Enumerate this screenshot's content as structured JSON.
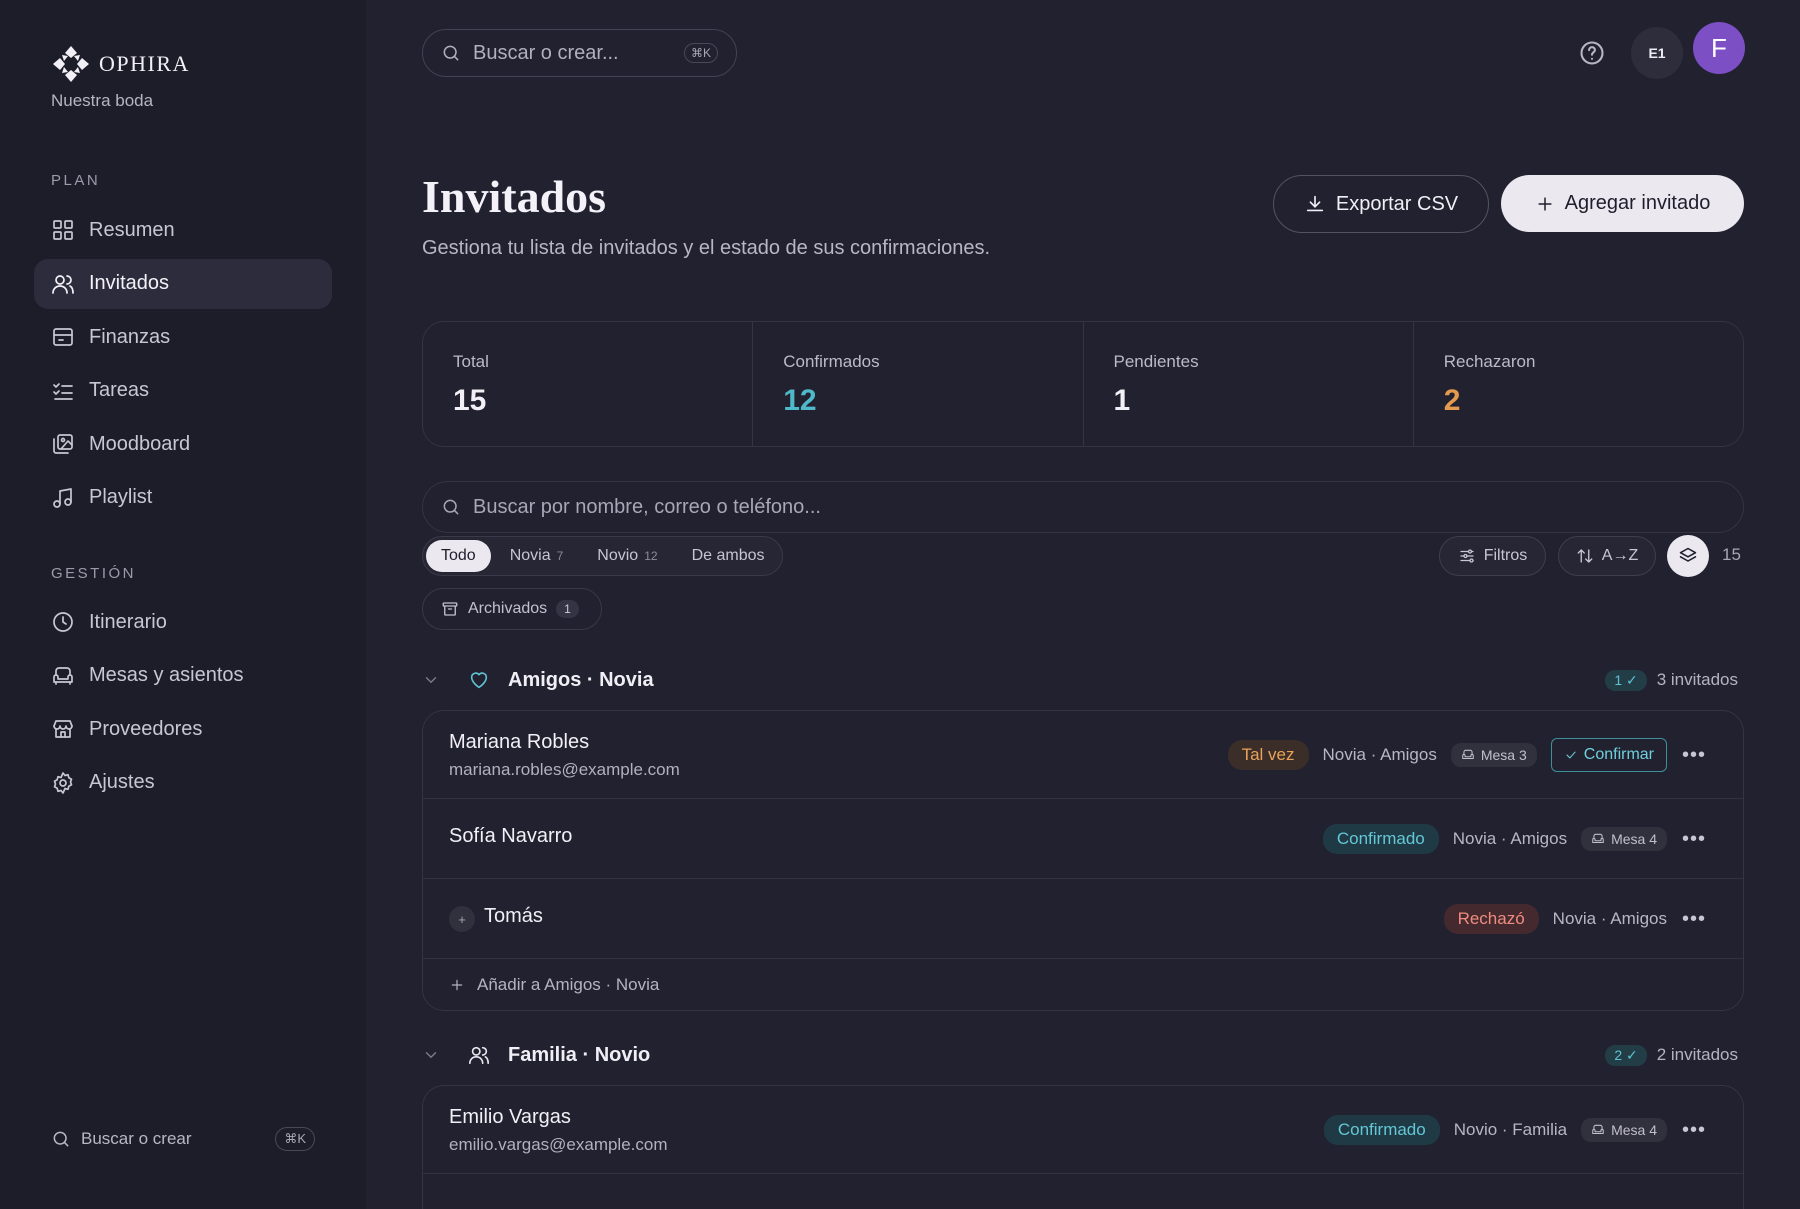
{
  "brand": {
    "name": "OPHIRA",
    "subtitle": "Nuestra boda"
  },
  "sidebar": {
    "plan_label": "PLAN",
    "plan_items": [
      {
        "label": "Resumen",
        "icon": "grid-icon",
        "active": false
      },
      {
        "label": "Invitados",
        "icon": "users-icon",
        "active": true
      },
      {
        "label": "Finanzas",
        "icon": "wallet-icon",
        "active": false
      },
      {
        "label": "Tareas",
        "icon": "checklist-icon",
        "active": false
      },
      {
        "label": "Moodboard",
        "icon": "images-icon",
        "active": false
      },
      {
        "label": "Playlist",
        "icon": "music-icon",
        "active": false
      }
    ],
    "gestion_label": "GESTIÓN",
    "gestion_items": [
      {
        "label": "Itinerario",
        "icon": "clock-icon"
      },
      {
        "label": "Mesas y asientos",
        "icon": "sofa-icon"
      },
      {
        "label": "Proveedores",
        "icon": "store-icon"
      },
      {
        "label": "Ajustes",
        "icon": "gear-icon"
      }
    ],
    "search_label": "Buscar o crear",
    "search_kbd": "⌘K"
  },
  "topbar": {
    "search_placeholder": "Buscar o crear...",
    "search_kbd": "⌘K",
    "workspace_chip": "E1",
    "avatar_initial": "F"
  },
  "header": {
    "title": "Invitados",
    "subtitle": "Gestiona tu lista de invitados y el estado de sus confirmaciones.",
    "export_label": "Exportar CSV",
    "add_label": "Agregar invitado"
  },
  "stats": [
    {
      "label": "Total",
      "value": "15",
      "color": "#f2f0f6"
    },
    {
      "label": "Confirmados",
      "value": "12",
      "color": "#4fb8c9"
    },
    {
      "label": "Pendientes",
      "value": "1",
      "color": "#f2f0f6"
    },
    {
      "label": "Rechazaron",
      "value": "2",
      "color": "#e39a4f"
    }
  ],
  "guest_search": {
    "placeholder": "Buscar por nombre, correo o teléfono..."
  },
  "filters": {
    "segments": [
      {
        "label": "Todo",
        "count": ""
      },
      {
        "label": "Novia",
        "count": "7"
      },
      {
        "label": "Novio",
        "count": "12"
      },
      {
        "label": "De ambos",
        "count": ""
      }
    ],
    "filtros_label": "Filtros",
    "sort_label": "A→Z",
    "result_count": "15",
    "archived_label": "Archivados",
    "archived_count": "1"
  },
  "groups": [
    {
      "name": "Amigos · Novia",
      "icon": "heart-icon",
      "confirmed_badge": "1 ✓",
      "count_label": "3 invitados",
      "add_label": "Añadir a Amigos · Novia",
      "guests": [
        {
          "name": "Mariana Robles",
          "email": "mariana.robles@example.com",
          "status": "Tal vez",
          "tag": "Novia · Amigos",
          "mesa": "Mesa 3",
          "confirm_label": "Confirmar"
        },
        {
          "name": "Sofía Navarro",
          "email": "",
          "status": "Confirmado",
          "tag": "Novia · Amigos",
          "mesa": "Mesa 4"
        },
        {
          "name": "Tomás",
          "email": "",
          "status": "Rechazó",
          "tag": "Novia · Amigos",
          "mesa": ""
        }
      ]
    },
    {
      "name": "Familia · Novio",
      "icon": "users-icon",
      "confirmed_badge": "2 ✓",
      "count_label": "2 invitados",
      "guests": [
        {
          "name": "Emilio Vargas",
          "email": "emilio.vargas@example.com",
          "status": "Confirmado",
          "tag": "Novio · Familia",
          "mesa": "Mesa 4"
        }
      ]
    }
  ]
}
